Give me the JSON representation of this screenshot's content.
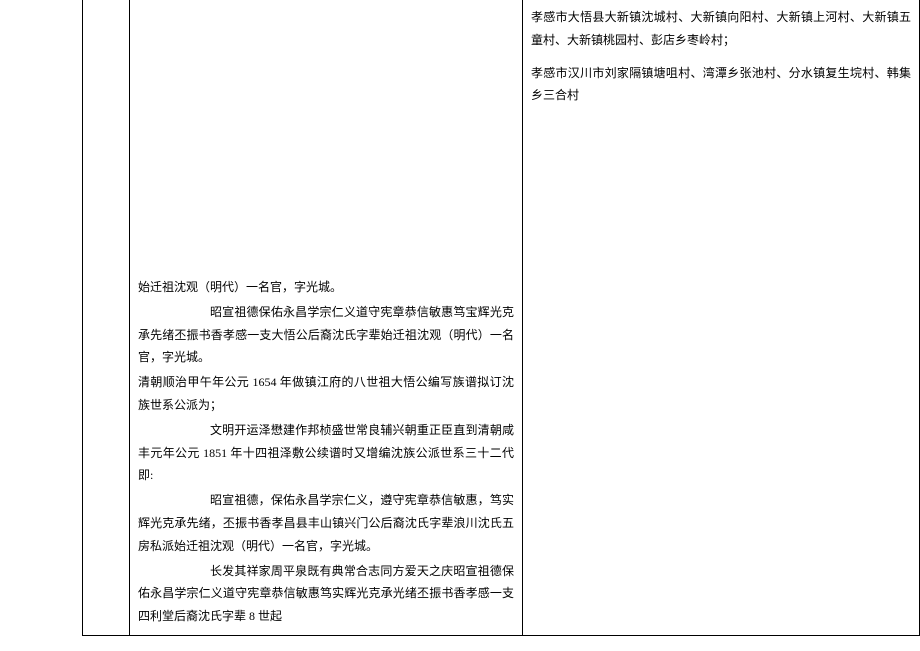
{
  "middle": {
    "p1": "始迁祖沈观（明代）一名官，字光城。",
    "p2": "昭宣祖德保佑永昌学宗仁义道守宪章恭信敏惠笃宝辉光克承先绪丕振书香孝感一支大悟公后裔沈氏字辈始迁祖沈观（明代）一名官，字光城。",
    "p3": "清朝顺治甲午年公元 1654 年做镇江府的八世祖大悟公编写族谱拟订沈族世系公派为；",
    "p4": "文明开运泽懋建作邦桢盛世常良辅兴朝重正臣直到清朝咸丰元年公元 1851 年十四祖泽敷公续谱时又增编沈族公派世系三十二代即:",
    "p5": "昭宣祖德，保佑永昌学宗仁义，遵守宪章恭信敏惠，笃实辉光克承先绪，丕振书香孝昌县丰山镇兴门公后裔沈氏字辈浪川沈氏五房私派始迁祖沈观（明代）一名官，字光城。",
    "p6": "长发其祥家周平泉既有典常合志同方爱天之庆昭宣祖德保佑永昌学宗仁义道守宪章恭信敏惠笃实辉光克承光绪丕振书香孝感一支四利堂后裔沈氏字辈 8 世起"
  },
  "right": {
    "p1": "孝感市大悟县大新镇沈城村、大新镇向阳村、大新镇上河村、大新镇五童村、大新镇桃园村、彭店乡枣岭村；",
    "p2": "孝感市汉川市刘家隔镇塘咀村、湾潭乡张池村、分水镇复生垸村、韩集乡三合村"
  }
}
